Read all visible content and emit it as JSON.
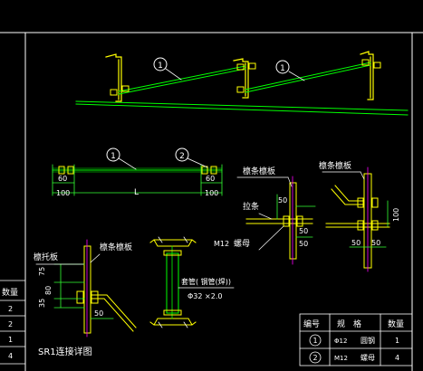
{
  "colors": {
    "background": "#000000",
    "frame": "#ffffff",
    "drawing": "#00ff00",
    "detail": "#ffff00",
    "dimension": "#33ff33",
    "magenta": "#ff00ff",
    "text": "#ffffff"
  },
  "balloons": {
    "top_one_a": "1",
    "top_one_b": "1",
    "rod_one": "1",
    "rod_two": "2"
  },
  "rod_dims": {
    "left_60": "60",
    "left_100": "100",
    "length": "L",
    "right_60": "60",
    "right_100": "100"
  },
  "right_detail_a": {
    "label_plate": "檩条檩板",
    "label_rod": "拉条",
    "label_nut": "螺母",
    "label_bolt": "M12",
    "dim_50_top": "50",
    "dim_50_right": "50",
    "dim_50_bottom": "50"
  },
  "right_detail_b": {
    "label_plate": "檩条檩板",
    "dim_100": "100",
    "dim_50_left": "50",
    "dim_50_right": "50"
  },
  "left_detail": {
    "label_plate": "檩托板",
    "label_purlin_plate": "檩条檩板",
    "dim_75": "75",
    "dim_80": "80",
    "dim_35": "35",
    "dim_50": "50"
  },
  "middle_detail": {
    "label_sleeve": "套管( 钢管(焊))",
    "label_size": "Φ32 ×2.0",
    "label_bolt": "M12"
  },
  "left_table": {
    "header": "数量",
    "values": [
      "2",
      "2",
      "1",
      "4"
    ]
  },
  "caption": "SR1连接详图",
  "spec_table": {
    "headers": [
      "编号",
      "规　格",
      "",
      "数量"
    ],
    "rows": [
      {
        "no": "1",
        "spec": "Φ12",
        "name": "圆钢",
        "qty": "1"
      },
      {
        "no": "2",
        "spec": "M12",
        "name": "螺母",
        "qty": "4"
      }
    ]
  }
}
